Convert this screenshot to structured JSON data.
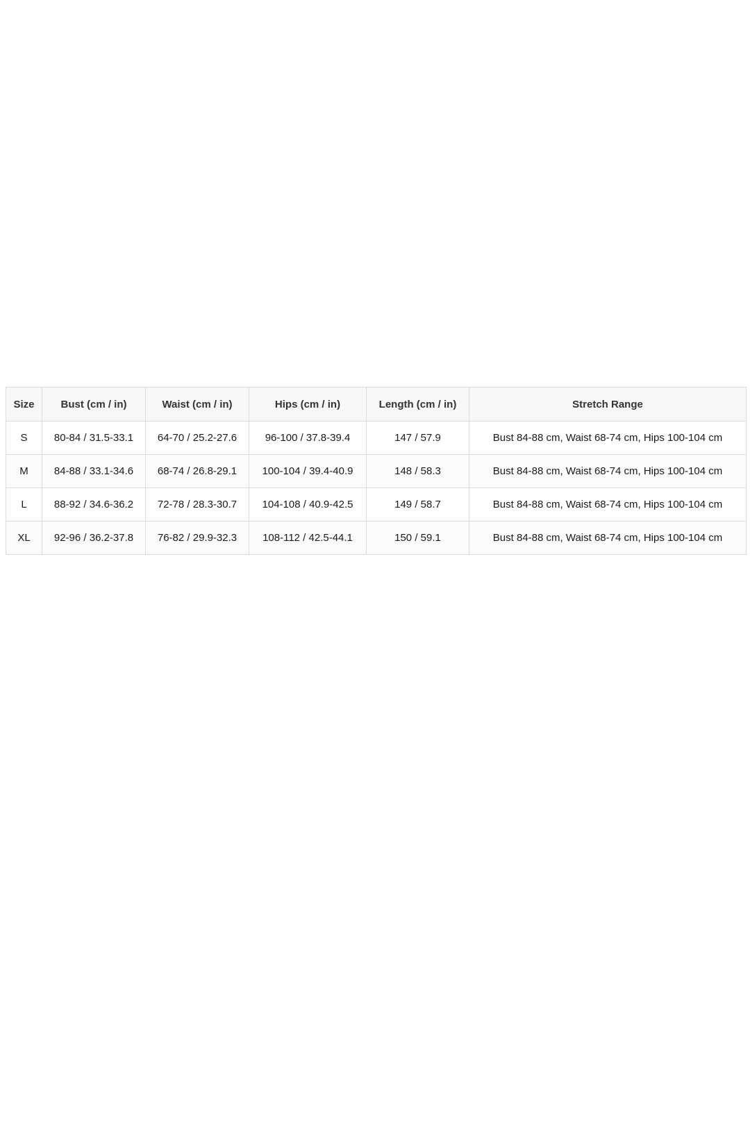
{
  "size_chart": {
    "headers": [
      "Size",
      "Bust (cm / in)",
      "Waist (cm / in)",
      "Hips (cm / in)",
      "Length (cm / in)",
      "Stretch Range"
    ],
    "rows": [
      [
        "S",
        "80-84 / 31.5-33.1",
        "64-70 / 25.2-27.6",
        "96-100 / 37.8-39.4",
        "147 / 57.9",
        "Bust 84-88 cm, Waist 68-74 cm, Hips 100-104 cm"
      ],
      [
        "M",
        "84-88 / 33.1-34.6",
        "68-74 / 26.8-29.1",
        "100-104 / 39.4-40.9",
        "148 / 58.3",
        "Bust 84-88 cm, Waist 68-74 cm, Hips 100-104 cm"
      ],
      [
        "L",
        "88-92 / 34.6-36.2",
        "72-78 / 28.3-30.7",
        "104-108 / 40.9-42.5",
        "149 / 58.7",
        "Bust 84-88 cm, Waist 68-74 cm, Hips 100-104 cm"
      ],
      [
        "XL",
        "92-96 / 36.2-37.8",
        "76-82 / 29.9-32.3",
        "108-112 / 42.5-44.1",
        "150 / 59.1",
        "Bust 84-88 cm, Waist 68-74 cm, Hips 100-104 cm"
      ]
    ]
  }
}
